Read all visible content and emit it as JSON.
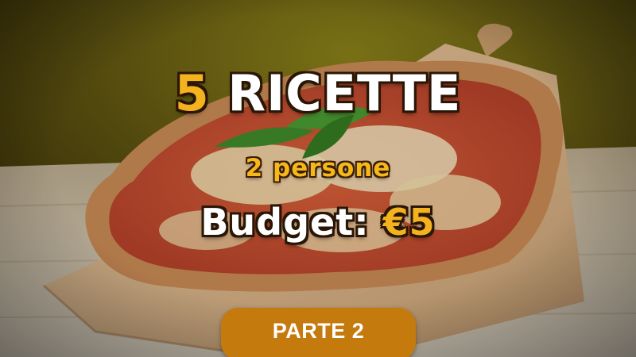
{
  "title": {
    "number": "5",
    "word": "RICETTE"
  },
  "subtitle": "2 persone",
  "budget": {
    "label": "Budget:",
    "amount": "€5"
  },
  "badge": {
    "label": "PARTE 2"
  },
  "colors": {
    "accent_yellow": "#f3b21e",
    "badge_orange": "#c57a0e",
    "background_olive": "#6e6514"
  }
}
